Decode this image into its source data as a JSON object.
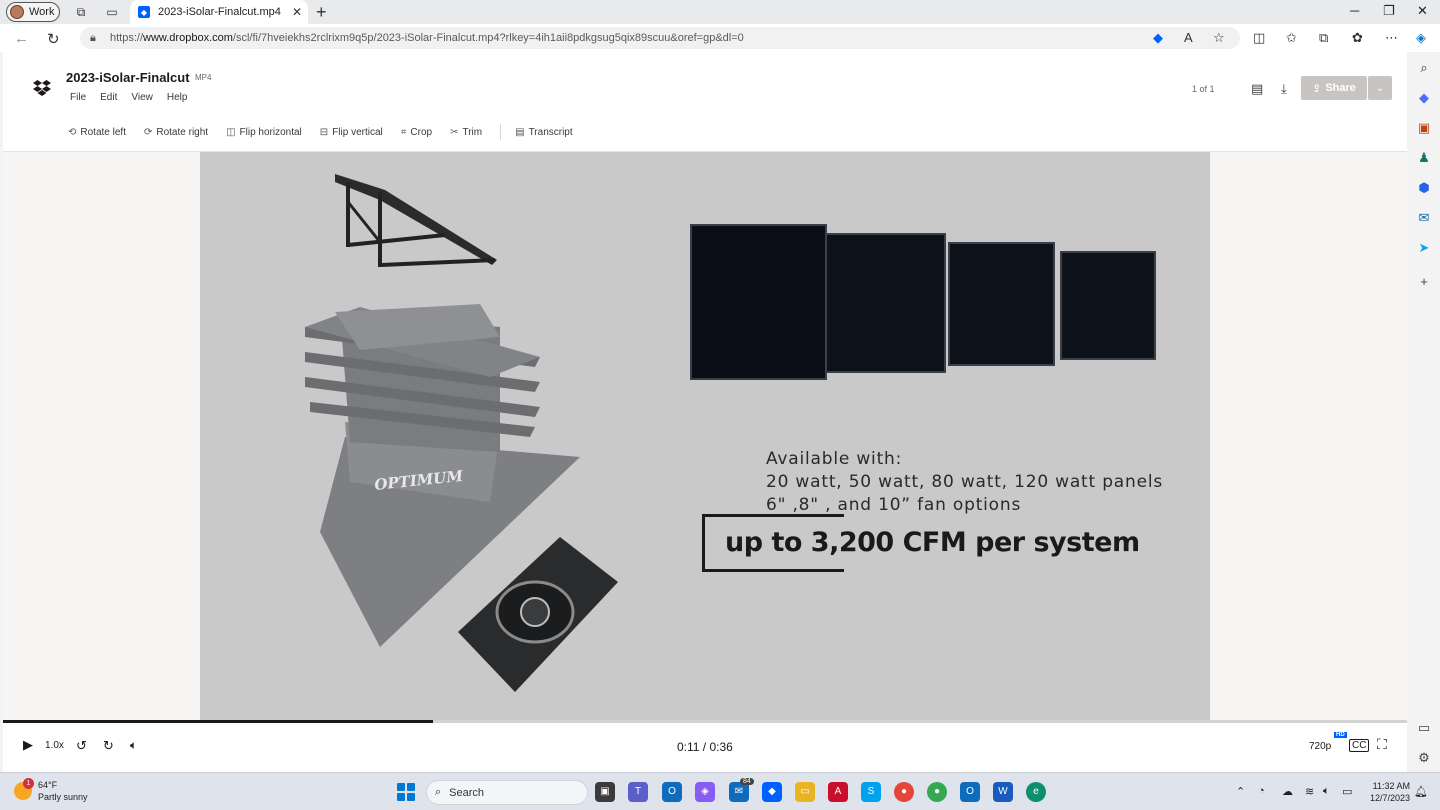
{
  "browser": {
    "profile_label": "Work",
    "tab_title": "2023-iSolar-Finalcut.mp4",
    "url_prefix": "https://",
    "url_domain": "www.dropbox.com",
    "url_rest": "/scl/fi/7hveiekhs2rclrixm9q5p/2023-iSolar-Finalcut.mp4?rlkey=4ih1aii8pdkgsug5qix89scuu&oref=gp&dl=0"
  },
  "viewer": {
    "file_name": "2023-iSolar-Finalcut",
    "file_ext": "MP4",
    "menu": [
      "File",
      "Edit",
      "View",
      "Help"
    ],
    "page_count": "1 of 1",
    "share_label": "Share",
    "tools": [
      {
        "label": "Rotate left",
        "icon": "rotate-left-icon"
      },
      {
        "label": "Rotate right",
        "icon": "rotate-right-icon"
      },
      {
        "label": "Flip horizontal",
        "icon": "flip-horizontal-icon"
      },
      {
        "label": "Flip vertical",
        "icon": "flip-vertical-icon"
      },
      {
        "label": "Crop",
        "icon": "crop-icon"
      },
      {
        "label": "Trim",
        "icon": "trim-icon"
      },
      {
        "label": "Transcript",
        "icon": "transcript-icon"
      }
    ]
  },
  "video_frame": {
    "brand_on_vent": "OPTIMUM",
    "available_lines": [
      "Available with:",
      "20 watt, 50 watt, 80 watt, 120 watt panels",
      "6\" ,8\" , and 10” fan options"
    ],
    "headline": "up to 3,200 CFM per system"
  },
  "player": {
    "speed": "1.0x",
    "current_time": "0:11",
    "duration": "0:36",
    "time_display": "0:11 / 0:36",
    "progress_fraction": 0.306,
    "quality": "720p",
    "hd_badge": "HD"
  },
  "taskbar": {
    "weather_temp": "64°F",
    "weather_desc": "Partly sunny",
    "weather_alert_count": "1",
    "search_label": "Search",
    "mail_badge": "84",
    "time": "11:32 AM",
    "date": "12/7/2023"
  },
  "colors": {
    "dropbox_blue": "#0061fe",
    "frame_bg": "#c9c9c9",
    "share_disabled": "#c7c4c1"
  }
}
